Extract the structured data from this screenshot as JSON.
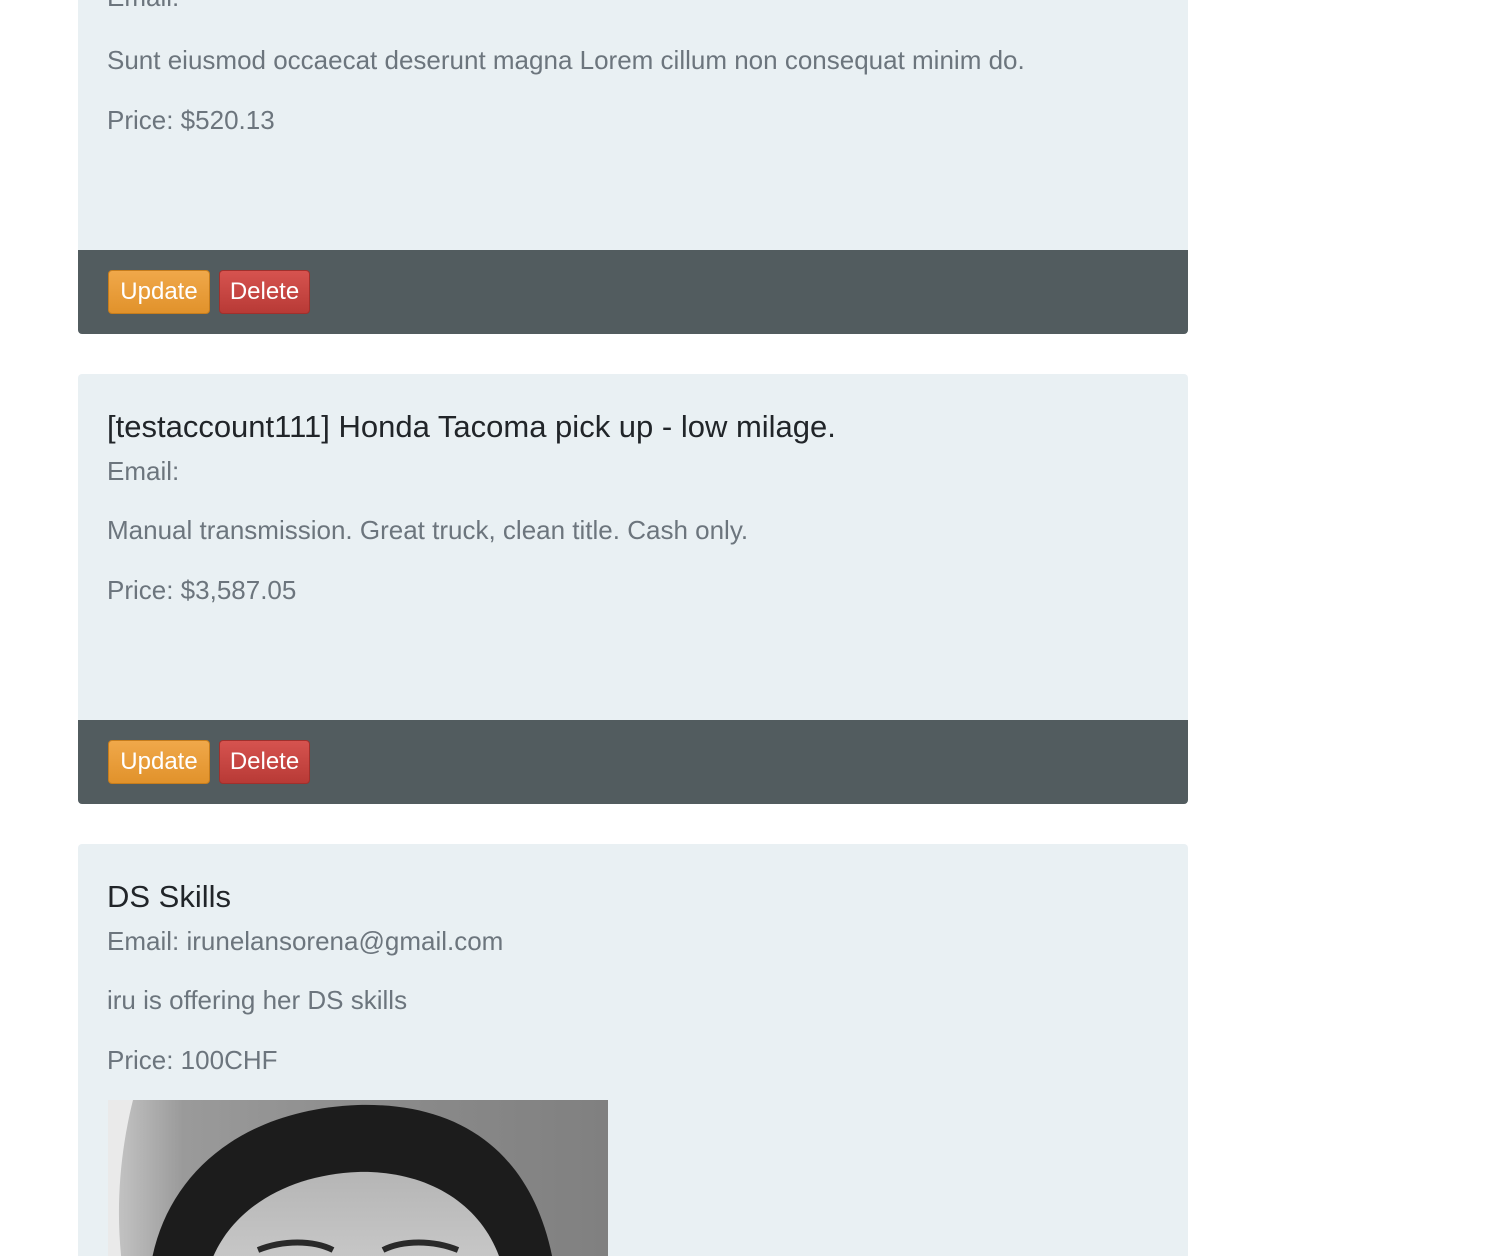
{
  "listings": [
    {
      "title": "",
      "email_label": "Email:",
      "description": "Sunt eiusmod occaecat deserunt magna Lorem cillum non consequat minim do.",
      "price_label": "Price: $520.13",
      "update_label": "Update",
      "delete_label": "Delete"
    },
    {
      "title": "[testaccount111] Honda Tacoma pick up - low milage.",
      "email_label": "Email:",
      "description": "Manual transmission. Great truck, clean title. Cash only.",
      "price_label": "Price: $3,587.05",
      "update_label": "Update",
      "delete_label": "Delete"
    },
    {
      "title": "DS Skills",
      "email_label": "Email: irunelansorena@gmail.com",
      "description": "iru is offering her DS skills",
      "price_label": "Price: 100CHF",
      "image": "grayscale-portrait-photo"
    }
  ],
  "colors": {
    "card_bg": "#e9f0f3",
    "footer_bg": "#525c5f",
    "update_button": "#e8992f",
    "delete_button": "#c9433f",
    "title_text": "#212529",
    "muted_text": "#6c757d"
  }
}
